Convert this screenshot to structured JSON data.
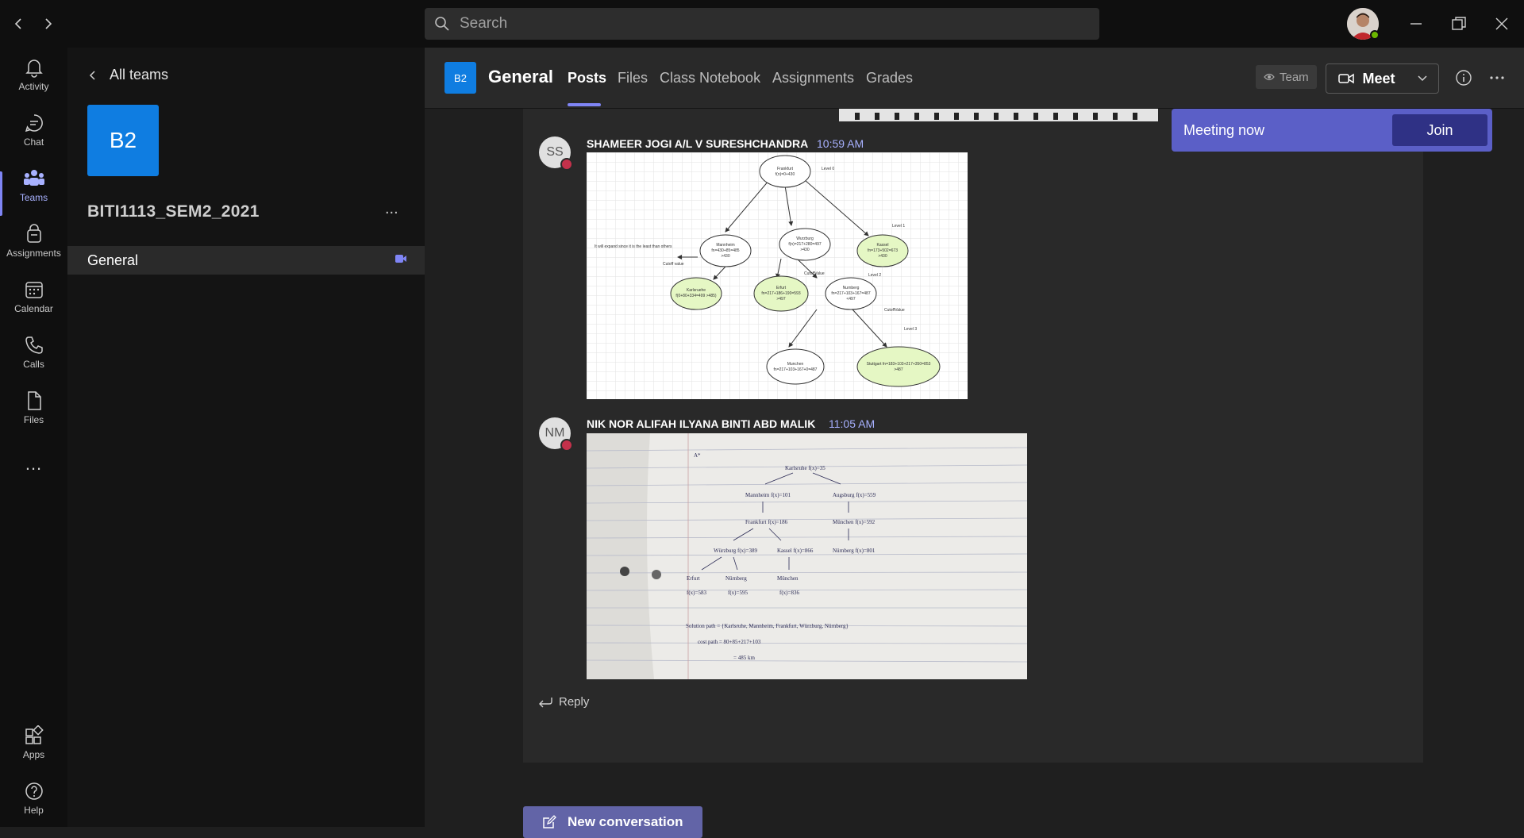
{
  "window": {
    "search_placeholder": "Search"
  },
  "rail": {
    "items": [
      {
        "label": "Activity",
        "icon": "bell-icon"
      },
      {
        "label": "Chat",
        "icon": "chat-icon"
      },
      {
        "label": "Teams",
        "icon": "teams-icon",
        "active": true
      },
      {
        "label": "Assignments",
        "icon": "assignments-icon"
      },
      {
        "label": "Calendar",
        "icon": "calendar-icon"
      },
      {
        "label": "Calls",
        "icon": "phone-icon"
      },
      {
        "label": "Files",
        "icon": "file-icon"
      }
    ],
    "more": "...",
    "bottom": [
      {
        "label": "Apps",
        "icon": "apps-icon"
      },
      {
        "label": "Help",
        "icon": "help-icon"
      }
    ]
  },
  "sidebar": {
    "back_label": "All teams",
    "team_avatar": "B2",
    "team_name": "BITI1113_SEM2_2021",
    "more": "...",
    "channels": [
      {
        "name": "General",
        "active": true
      }
    ]
  },
  "header": {
    "avatar": "B2",
    "channel_title": "General",
    "tabs": [
      "Posts",
      "Files",
      "Class Notebook",
      "Assignments",
      "Grades"
    ],
    "active_tab": "Posts",
    "team_pill": "Team",
    "meet_label": "Meet"
  },
  "meeting_banner": {
    "text": "Meeting now",
    "join_label": "Join"
  },
  "messages": [
    {
      "initials": "SS",
      "author": "SHAMEER JOGI A/L V SURESHCHANDRA",
      "time": "10:59 AM",
      "attachment": "search-tree-diagram",
      "diagram_text": {
        "level0": "Level 0",
        "level1": "Level 1",
        "level2": "Level 2",
        "level3": "Level 3",
        "note_expand": "It will expand since it is the least than others",
        "cutoff1": "Cutoff value",
        "cutoff2": "CutoffValue",
        "cutoff3": "CutoffValue",
        "n_frankfurt_1": "Frankfurt",
        "n_frankfurt_2": "f(n)=0+430",
        "n_mannheim_1": "Mannheim",
        "n_mannheim_2": "fn=430+85=485",
        "n_mannheim_3": ">430",
        "n_wurzburg_1": "Wurzburg",
        "n_wurzburg_2": "f(n)=217+280=497",
        "n_wurzburg_3": ">430",
        "n_kassel_1": "Kassel",
        "n_kassel_2": "fn=173+502=673",
        "n_kassel_3": ">430",
        "n_karlsruhe_1": "Karlsruehe",
        "n_karlsruhe_2": "f(0+80+334=499 >485)",
        "n_erfurt_1": "Erfurt",
        "n_erfurt_2": "fn=217+186+190=593",
        "n_erfurt_3": ">497",
        "n_nurnberg_1": "Nurnberg",
        "n_nurnberg_2": "fn=217+103+167=487",
        "n_nurnberg_3": "<497",
        "n_munchen_1": "Munchen",
        "n_munchen_2": "fn=217+103+167+0=487",
        "n_stuttgart_1": "Stuttgart fn=183+103+217+350=853",
        "n_stuttgart_2": ">487"
      }
    },
    {
      "initials": "NM",
      "author": "NIK NOR ALIFAH ILYANA BINTI ABD MALIK",
      "time": "11:05 AM",
      "attachment": "handwritten-notes-photo",
      "notes_text": {
        "astar": "A*",
        "karlsruhe": "Karlsruhe  f(x)=35",
        "mannheim": "Mannheim  f(x)=101",
        "augsburg": "Augsburg  f(x)=559",
        "frankfurt": "Frankfurt  f(x)=186",
        "munchen1": "München  f(x)=592",
        "wurzburg": "Würzburg  f(x)=389",
        "kassel": "Kassel  f(x)=866",
        "nurnberg1": "Nürnberg  f(x)=801",
        "erfurt": "Erfurt",
        "nurnberg2": "Nürnberg",
        "munchen2": "München",
        "fx1": "f(x)=583",
        "fx2": "f(x)=595",
        "fx3": "f(x)=836",
        "solution": "Solution  path = {Karlsruhe, Mannheim, Frankfurt, Würzburg, Nürnberg}",
        "cost": "cost  path = 80+85+217+103",
        "total": "= 485 km"
      }
    }
  ],
  "reply_label": "Reply",
  "new_conversation_label": "New conversation"
}
